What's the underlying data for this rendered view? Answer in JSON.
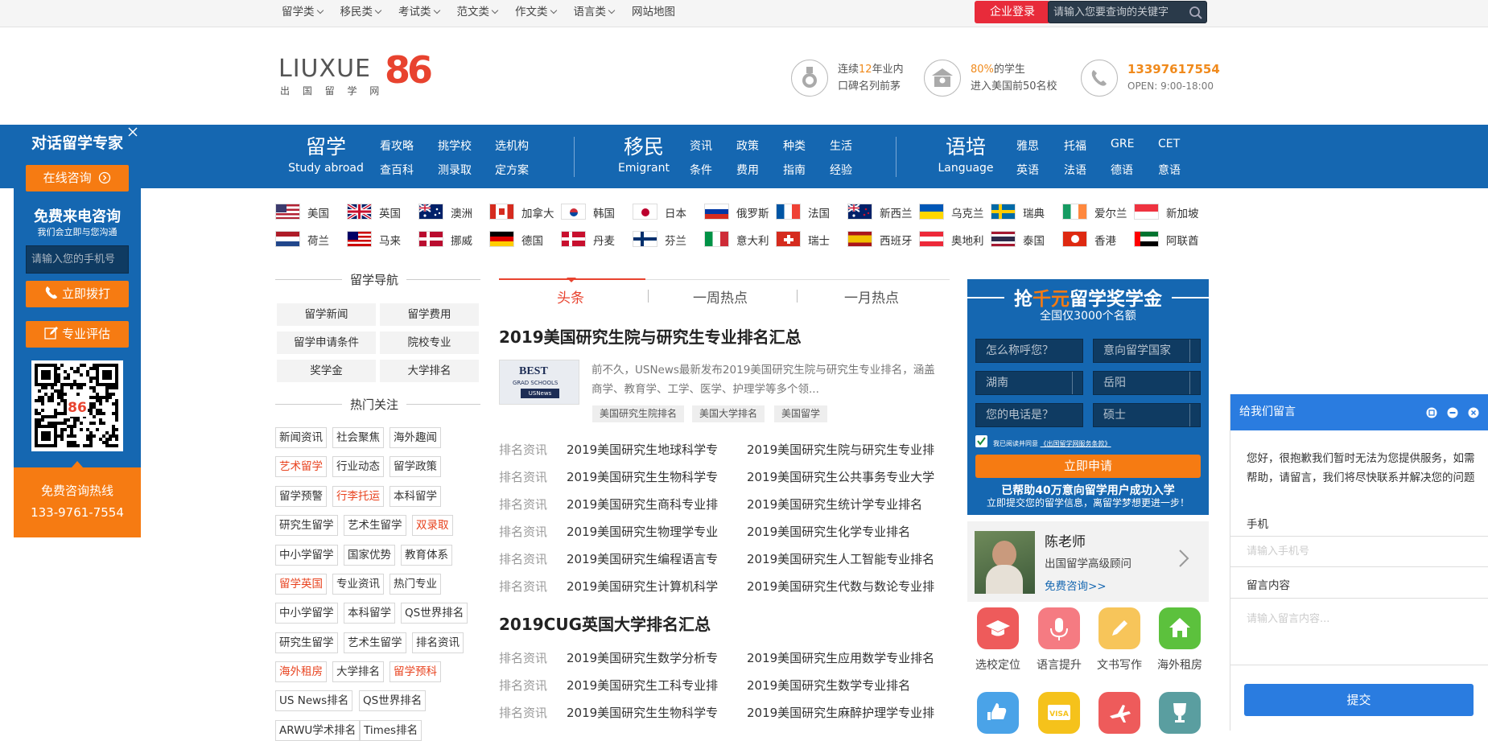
{
  "topbar": {
    "menu": [
      "留学类",
      "移民类",
      "考试类",
      "范文类",
      "作文类",
      "语言类",
      "网站地图"
    ],
    "login": "企业登录",
    "search_placeholder": "请输入您要查询的关键字"
  },
  "logo": {
    "text": "LIUXUE",
    "number": "86",
    "sub": "出 国 留 学 网"
  },
  "features": [
    {
      "line1_pre": "连续",
      "line1_num": "12",
      "line1_post": "年业内",
      "line2": "口碑名列前茅"
    },
    {
      "line1_num": "80%",
      "line1_post": "的学生",
      "line2": "进入美国前50名校"
    },
    {
      "phone": "13397617554",
      "hours": "OPEN: 9:00-18:00"
    }
  ],
  "nav": {
    "study": {
      "title": "留学",
      "sub": "Study abroad",
      "links": [
        "看攻略",
        "挑学校",
        "选机构",
        "查百科",
        "测录取",
        "定方案"
      ]
    },
    "immig": {
      "title": "移民",
      "sub": "Emigrant",
      "links": [
        "资讯",
        "政策",
        "种类",
        "生活",
        "条件",
        "费用",
        "指南",
        "经验"
      ]
    },
    "lang": {
      "title": "语培",
      "sub": "Language",
      "links": [
        "雅思",
        "托福",
        "GRE",
        "CET",
        "英语",
        "法语",
        "德语",
        "意语"
      ]
    }
  },
  "countries": [
    [
      "美国",
      "英国",
      "澳洲",
      "加拿大",
      "韩国",
      "日本",
      "俄罗斯",
      "法国",
      "新西兰",
      "乌克兰",
      "瑞典",
      "爱尔兰",
      "新加坡"
    ],
    [
      "荷兰",
      "马来",
      "挪威",
      "德国",
      "丹麦",
      "芬兰",
      "意大利",
      "瑞士",
      "西班牙",
      "奥地利",
      "泰国",
      "香港",
      "阿联酋"
    ]
  ],
  "left": {
    "nav_title": "留学导航",
    "nav_items": [
      "留学新闻",
      "留学费用",
      "留学申请条件",
      "院校专业",
      "奖学金",
      "大学排名"
    ],
    "hot_title": "热门关注",
    "tags": [
      [
        "新闻资讯",
        "社会聚焦",
        "海外趣闻"
      ],
      [
        "艺术留学",
        "行业动态",
        "留学政策"
      ],
      [
        "留学预警",
        "行李托运",
        "本科留学"
      ],
      [
        "研究生留学",
        "艺术生留学",
        "双录取"
      ],
      [
        "中小学留学",
        "国家优势",
        "教育体系"
      ],
      [
        "留学英国",
        "专业资讯",
        "热门专业"
      ],
      [
        "中小学留学",
        "本科留学",
        "QS世界排名"
      ],
      [
        "研究生留学",
        "艺术生留学",
        "排名资讯"
      ],
      [
        "海外租房",
        "大学排名",
        "留学预科"
      ],
      [
        "US News排名",
        "QS世界排名"
      ],
      [
        "ARWU学术排名",
        "Times排名"
      ]
    ]
  },
  "center": {
    "tabs": [
      "头条",
      "一周热点",
      "一月热点"
    ],
    "headline1": "2019美国研究生院与研究生专业排名汇总",
    "summary": "前不久，USNews最新发布2019美国研究生院与研究生专业排名，涵盖商学、教育学、工学、医学、护理学等多个领...",
    "thumb_text": [
      "BEST",
      "GRAD SCHOOLS",
      "USNews"
    ],
    "keywords": [
      "美国研究生院排名",
      "美国大学排名",
      "美国留学"
    ],
    "category": "排名资讯",
    "list1": [
      [
        "2019美国研究生地球科学专",
        "2019美国研究生院与研究生专业排"
      ],
      [
        "2019美国研究生生物科学专",
        "2019美国研究生公共事务专业大学"
      ],
      [
        "2019美国研究生商科专业排",
        "2019美国研究生统计学专业排名"
      ],
      [
        "2019美国研究生物理学专业",
        "2019美国研究生化学专业排名"
      ],
      [
        "2019美国研究生编程语言专",
        "2019美国研究生人工智能专业排名"
      ],
      [
        "2019美国研究生计算机科学",
        "2019美国研究生代数与数论专业排"
      ]
    ],
    "headline2": "2019CUG英国大学排名汇总",
    "list2": [
      [
        "2019美国研究生数学分析专",
        "2019美国研究生应用数学专业排名"
      ],
      [
        "2019美国研究生工科专业排",
        "2019美国研究生数学专业排名"
      ],
      [
        "2019美国研究生生物科学专",
        "2019美国研究生麻醉护理学专业排"
      ]
    ]
  },
  "promo": {
    "title_pre": "抢",
    "title_hl": "千元",
    "title_post": "留学奖学金",
    "subtitle": "全国仅3000个名额",
    "name_ph": "怎么称呼您？",
    "country_ph": "意向留学国家",
    "province": "湖南",
    "city": "岳阳",
    "phone_ph": "您的电话是？",
    "degree": "硕士",
    "agree": "我已阅读并同意",
    "agree_link": "《出国留学网服务条款》",
    "apply": "立即申请",
    "bottom1": "已帮助40万意向留学用户成功入学",
    "bottom2": "立即提交您的留学信息，离留学梦想更进一步！"
  },
  "teacher": {
    "name": "陈老师",
    "title": "出国留学高级顾问",
    "link": "免费咨询>>"
  },
  "services": [
    "选校定位",
    "语言提升",
    "文书写作",
    "海外租房"
  ],
  "float": {
    "title": "对话留学专家",
    "online": "在线咨询",
    "call_title": "免费来电咨询",
    "call_sub": "我们会立即与您沟通",
    "phone_ph": "请输入您的手机号",
    "dial": "立即拨打",
    "assess": "专业评估",
    "hotline_label": "免费咨询热线",
    "hotline": "133-9761-7554"
  },
  "chat": {
    "title": "给我们留言",
    "message": "您好，很抱歉我们暂时无法为您提供服务，如需帮助，请留言，我们将尽快联系并解决您的问题",
    "phone_label": "手机",
    "phone_ph": "请输入手机号",
    "content_label": "留言内容",
    "content_ph": "请输入留言内容...",
    "submit": "提交"
  },
  "colors": {
    "brand_blue": "#1567b1",
    "orange": "#f67b12",
    "red": "#e82b3a",
    "chat_blue": "#2a7ce0"
  }
}
